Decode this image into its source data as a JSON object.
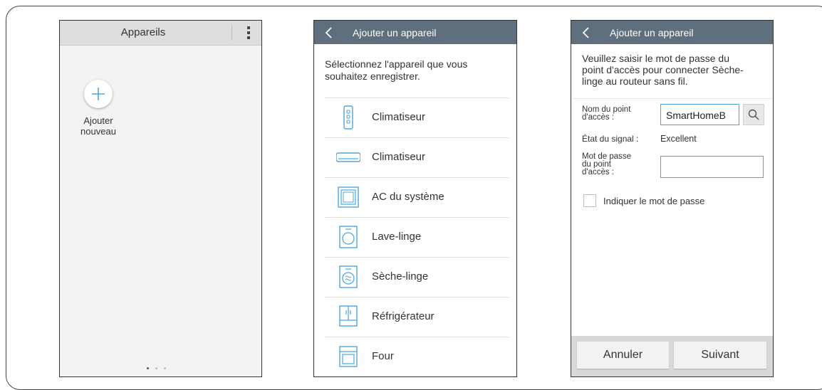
{
  "colors": {
    "accent": "#4ea6d8",
    "appbar": "#5f6f7d"
  },
  "screen1": {
    "title": "Appareils",
    "menu_icon": "more-vertical-icon",
    "add_icon": "plus-icon",
    "add_label_line1": "Ajouter",
    "add_label_line2": "nouveau"
  },
  "screen2": {
    "title": "Ajouter un appareil",
    "back_icon": "chevron-left-icon",
    "intro": "Sélectionnez l'appareil que vous souhaitez enregistrer.",
    "devices": [
      {
        "label": "Climatiseur",
        "icon": "air-conditioner-standing-icon"
      },
      {
        "label": "Climatiseur",
        "icon": "air-conditioner-wall-icon"
      },
      {
        "label": "AC du système",
        "icon": "system-ac-icon"
      },
      {
        "label": "Lave-linge",
        "icon": "washer-icon"
      },
      {
        "label": "Sèche-linge",
        "icon": "dryer-icon"
      },
      {
        "label": "Réfrigérateur",
        "icon": "refrigerator-icon"
      },
      {
        "label": "Four",
        "icon": "oven-icon"
      }
    ]
  },
  "screen3": {
    "title": "Ajouter un appareil",
    "back_icon": "chevron-left-icon",
    "intro_line1": "Veuillez saisir le mot de passe du",
    "intro_line2": "point d'accès pour connecter Sèche-",
    "intro_line3": "linge au routeur sans fil.",
    "ssid_label_line1": "Nom du point",
    "ssid_label_line2": "d'accès :",
    "ssid_value": "SmartHomeB",
    "search_icon": "search-icon",
    "signal_label": "État du signal :",
    "signal_value": "Excellent",
    "password_label_line1": "Mot de passe",
    "password_label_line2": "du point",
    "password_label_line3": "d'accès :",
    "password_value": "",
    "show_password_label": "Indiquer le mot de passe",
    "cancel_label": "Annuler",
    "next_label": "Suivant"
  }
}
